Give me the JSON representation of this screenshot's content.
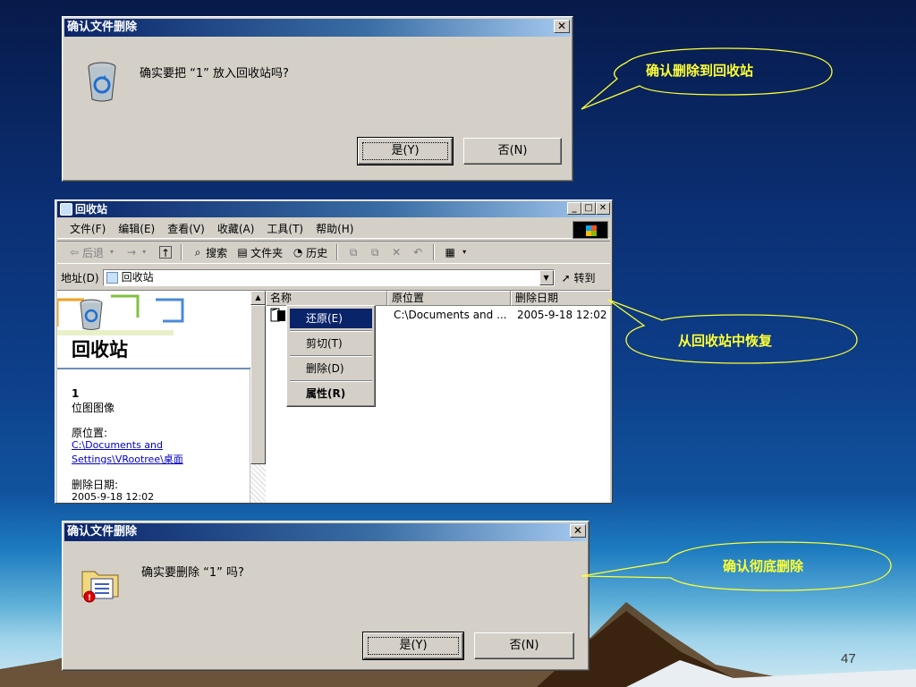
{
  "dialog1": {
    "title": "确认文件删除",
    "close": "✕",
    "message": "确实要把 “1” 放入回收站吗?",
    "yes": "是(Y)",
    "no": "否(N)"
  },
  "callout1": {
    "text": "确认删除到回收站"
  },
  "explorer": {
    "title": "回收站",
    "window_buttons": [
      "_",
      "□",
      "✕"
    ],
    "menu": [
      "文件(F)",
      "编辑(E)",
      "查看(V)",
      "收藏(A)",
      "工具(T)",
      "帮助(H)"
    ],
    "toolbar": {
      "back": "后退",
      "forward": "→",
      "search": "搜索",
      "folders": "文件夹",
      "history": "历史"
    },
    "address_label": "地址(D)",
    "address_value": "回收站",
    "goto": "转到",
    "left_pane": {
      "title": "回收站",
      "file_name": "1",
      "file_type": "位图图像",
      "origin_label": "原位置:",
      "origin_link_1": "C:\\Documents and",
      "origin_link_2": "Settings\\VRootree\\桌面",
      "deleted_label": "删除日期:",
      "deleted_value": "2005-9-18 12:02"
    },
    "columns": [
      "名称",
      "原位置",
      "删除日期"
    ],
    "row": {
      "origin": "C:\\Documents and ...",
      "date": "2005-9-18 12:02"
    },
    "context_menu": [
      "还原(E)",
      "剪切(T)",
      "删除(D)",
      "属性(R)"
    ]
  },
  "callout2": {
    "text": "从回收站中恢复"
  },
  "dialog2": {
    "title": "确认文件删除",
    "close": "✕",
    "message": "确实要删除 “1” 吗?",
    "yes": "是(Y)",
    "no": "否(N)"
  },
  "callout3": {
    "text": "确认彻底删除"
  },
  "page_number": "47",
  "colors": {
    "titlebar": "#0a246a",
    "callout_text": "#ffff33",
    "dialog_face": "#d4d0c8"
  }
}
